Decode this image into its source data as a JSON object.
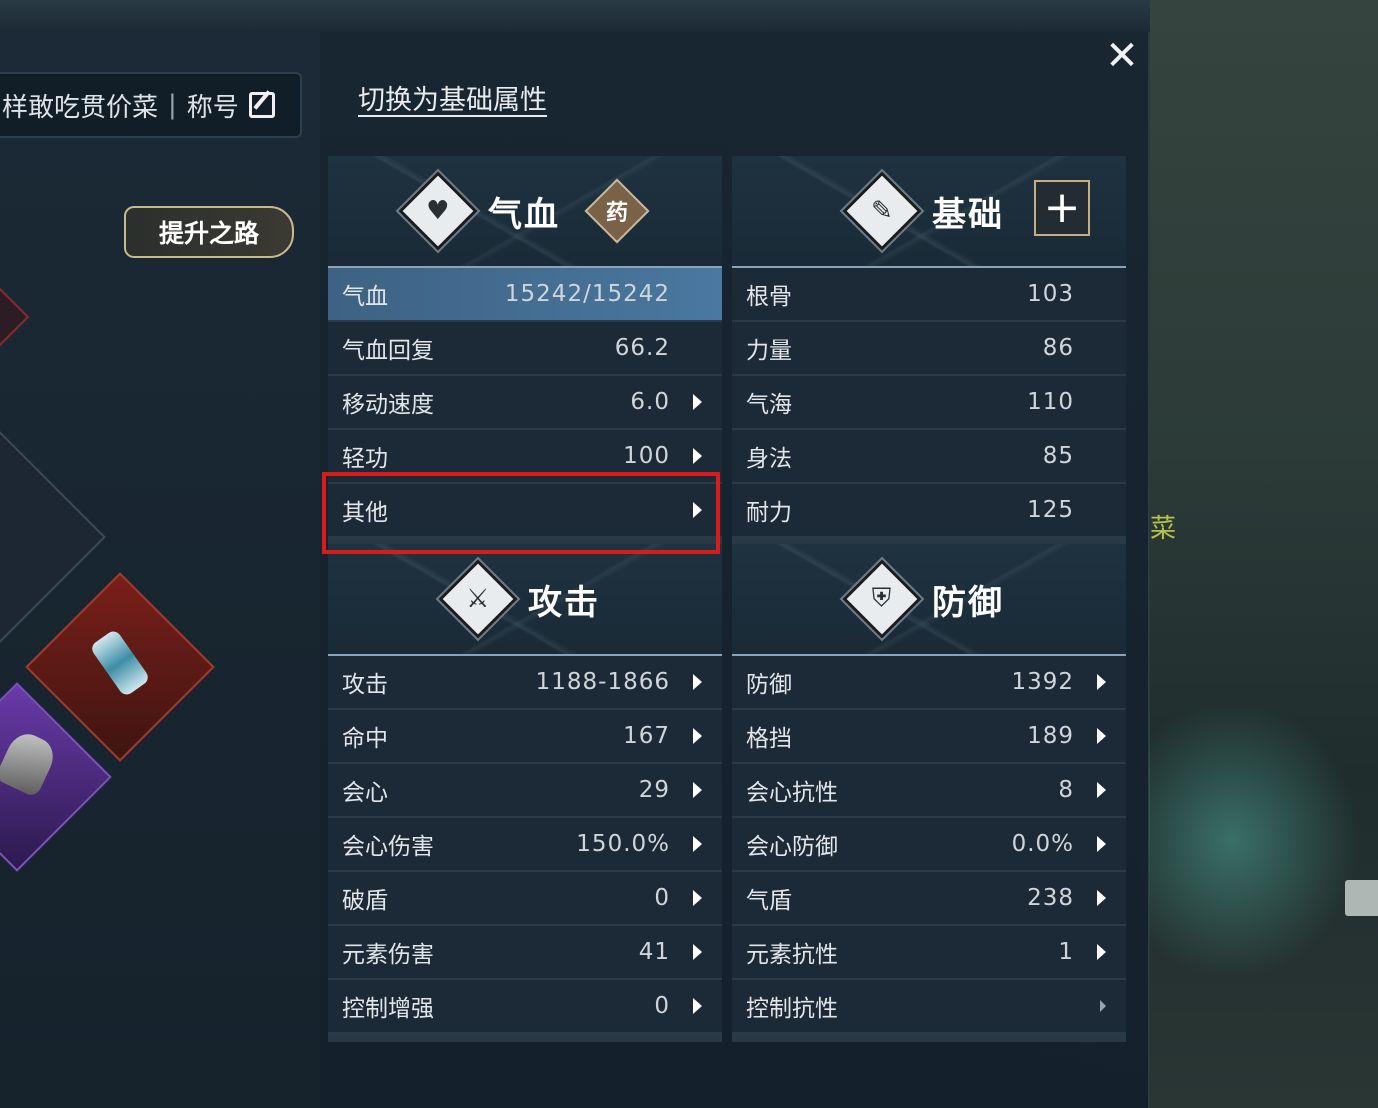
{
  "header": {
    "name_text": "样敢吃贯价菜",
    "separator": "|",
    "title_label": "称号",
    "switch_label": "切换为基础属性",
    "close_glyph": "✕"
  },
  "left": {
    "promote_label": "提升之路"
  },
  "side_char": "菜",
  "sections": {
    "hp": {
      "title": "气血",
      "icon_glyph": "♥",
      "med_label": "药",
      "rows": [
        {
          "label": "气血",
          "value": "15242/15242"
        },
        {
          "label": "气血回复",
          "value": "66.2"
        },
        {
          "label": "移动速度",
          "value": "6.0"
        },
        {
          "label": "轻功",
          "value": "100"
        },
        {
          "label": "其他",
          "value": ""
        }
      ]
    },
    "basic": {
      "title": "基础",
      "icon_glyph": "✎",
      "plus_label": "+",
      "rows": [
        {
          "label": "根骨",
          "value": "103"
        },
        {
          "label": "力量",
          "value": "86"
        },
        {
          "label": "气海",
          "value": "110"
        },
        {
          "label": "身法",
          "value": "85"
        },
        {
          "label": "耐力",
          "value": "125"
        }
      ]
    },
    "attack": {
      "title": "攻击",
      "icon_glyph": "⚔",
      "rows": [
        {
          "label": "攻击",
          "value": "1188-1866"
        },
        {
          "label": "命中",
          "value": "167"
        },
        {
          "label": "会心",
          "value": "29"
        },
        {
          "label": "会心伤害",
          "value": "150.0%"
        },
        {
          "label": "破盾",
          "value": "0"
        },
        {
          "label": "元素伤害",
          "value": "41"
        },
        {
          "label": "控制增强",
          "value": "0"
        }
      ]
    },
    "defense": {
      "title": "防御",
      "icon_glyph": "⛨",
      "rows": [
        {
          "label": "防御",
          "value": "1392"
        },
        {
          "label": "格挡",
          "value": "189"
        },
        {
          "label": "会心抗性",
          "value": "8"
        },
        {
          "label": "会心防御",
          "value": "0.0%"
        },
        {
          "label": "气盾",
          "value": "238"
        },
        {
          "label": "元素抗性",
          "value": "1"
        },
        {
          "label": "控制抗性",
          "value": ""
        }
      ]
    }
  },
  "colors": {
    "highlight_row": "#4a78a0",
    "annotation_box": "#d81c1c",
    "accent_gold": "#c8ad82"
  }
}
